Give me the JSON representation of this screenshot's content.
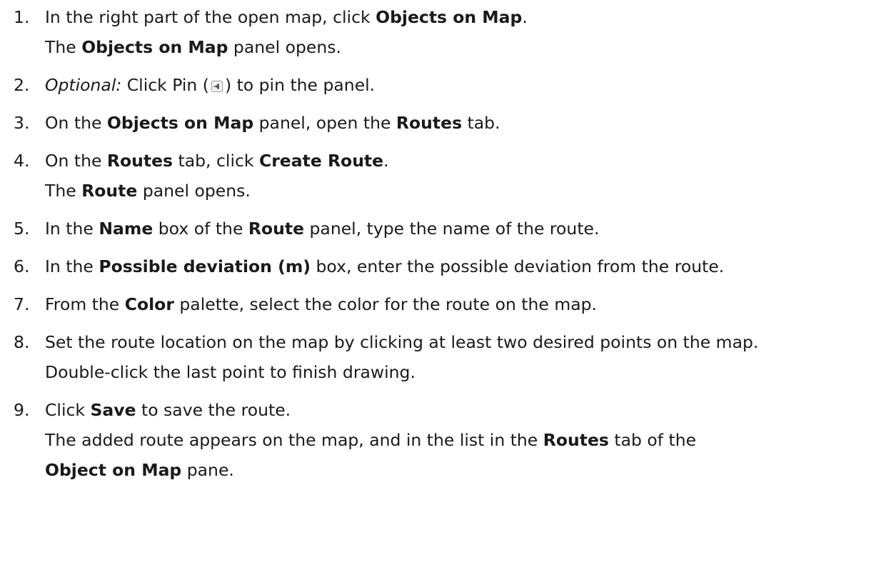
{
  "steps": [
    {
      "number": "1.",
      "lines": [
        [
          {
            "t": "In the right part of the open map, click "
          },
          {
            "t": "Objects on Map",
            "b": true
          },
          {
            "t": "."
          }
        ],
        [
          {
            "t": "The "
          },
          {
            "t": "Objects on Map",
            "b": true
          },
          {
            "t": " panel opens."
          }
        ]
      ]
    },
    {
      "number": "2.",
      "lines": [
        [
          {
            "t": "Optional:",
            "i": true
          },
          {
            "t": " Click Pin ("
          },
          {
            "icon": "pin-icon"
          },
          {
            "t": ") to pin the panel."
          }
        ]
      ]
    },
    {
      "number": "3.",
      "lines": [
        [
          {
            "t": "On the "
          },
          {
            "t": "Objects on Map",
            "b": true
          },
          {
            "t": " panel, open the "
          },
          {
            "t": "Routes",
            "b": true
          },
          {
            "t": " tab."
          }
        ]
      ]
    },
    {
      "number": "4.",
      "lines": [
        [
          {
            "t": "On the "
          },
          {
            "t": "Routes",
            "b": true
          },
          {
            "t": " tab, click "
          },
          {
            "t": "Create Route",
            "b": true
          },
          {
            "t": "."
          }
        ],
        [
          {
            "t": "The "
          },
          {
            "t": "Route",
            "b": true
          },
          {
            "t": " panel opens."
          }
        ]
      ]
    },
    {
      "number": "5.",
      "lines": [
        [
          {
            "t": "In the "
          },
          {
            "t": "Name",
            "b": true
          },
          {
            "t": " box of the "
          },
          {
            "t": "Route",
            "b": true
          },
          {
            "t": " panel, type the name of the route."
          }
        ]
      ]
    },
    {
      "number": "6.",
      "lines": [
        [
          {
            "t": "In the "
          },
          {
            "t": "Possible deviation (m)",
            "b": true
          },
          {
            "t": " box, enter the possible deviation from the route."
          }
        ]
      ]
    },
    {
      "number": "7.",
      "lines": [
        [
          {
            "t": "From the "
          },
          {
            "t": "Color",
            "b": true
          },
          {
            "t": " palette, select the color for the route on the map."
          }
        ]
      ]
    },
    {
      "number": "8.",
      "lines": [
        [
          {
            "t": "Set the route location on the map by clicking at least two desired points on the map."
          }
        ],
        [
          {
            "t": "Double-click the last point to finish drawing."
          }
        ]
      ]
    },
    {
      "number": "9.",
      "lines": [
        [
          {
            "t": "Click "
          },
          {
            "t": "Save",
            "b": true
          },
          {
            "t": " to save the route."
          }
        ],
        [
          {
            "t": "The added route appears on the map, and in the list in the "
          },
          {
            "t": "Routes",
            "b": true
          },
          {
            "t": " tab of the"
          }
        ],
        [
          {
            "t": "Object on Map",
            "b": true
          },
          {
            "t": " pane."
          }
        ]
      ]
    }
  ]
}
